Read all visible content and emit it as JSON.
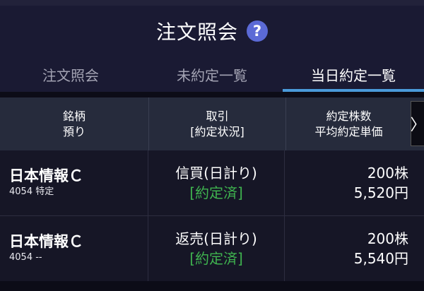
{
  "header": {
    "title": "注文照会",
    "help_label": "?"
  },
  "tabs": [
    {
      "label": "注文照会"
    },
    {
      "label": "未約定一覧"
    },
    {
      "label": "当日約定一覧"
    }
  ],
  "columns": {
    "col1": {
      "line1": "銘柄",
      "line2": "預り"
    },
    "col2": {
      "line1": "取引",
      "line2": "[約定状況]"
    },
    "col3": {
      "line1": "約定株数",
      "line2": "平均約定単価"
    },
    "more_label": "〉"
  },
  "rows": [
    {
      "name": "日本情報Ｃ",
      "sub": "4054 特定",
      "trade": "信買(日計り)",
      "status": "[約定済]",
      "qty": "200株",
      "price": "5,520円"
    },
    {
      "name": "日本情報Ｃ",
      "sub": "4054 --",
      "trade": "返売(日計り)",
      "status": "[約定済]",
      "qty": "200株",
      "price": "5,540円"
    }
  ],
  "colors": {
    "accent": "#4a9ad9",
    "status_green": "#3fb34f",
    "help_bg": "#5b6ad6"
  }
}
